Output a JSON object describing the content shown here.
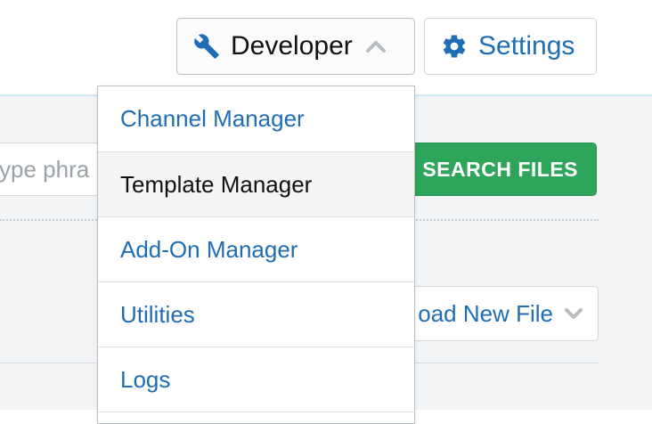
{
  "header": {
    "developer_label": "Developer",
    "settings_label": "Settings"
  },
  "search": {
    "placeholder": "ype phra",
    "button_label": "SEARCH FILES"
  },
  "upload": {
    "label": "oad New File"
  },
  "developer_menu": {
    "items": [
      {
        "label": "Channel Manager"
      },
      {
        "label": "Template Manager",
        "active": true
      },
      {
        "label": "Add-On Manager"
      },
      {
        "label": "Utilities"
      },
      {
        "label": "Logs"
      }
    ]
  },
  "colors": {
    "link_blue": "#1f6db5",
    "search_green": "#2ea55a",
    "content_bg": "#f2f4f6"
  },
  "icons": {
    "developer": "wrench-icon",
    "developer_toggle": "chevron-up-icon",
    "settings": "gear-icon",
    "upload_toggle": "chevron-down-icon"
  }
}
